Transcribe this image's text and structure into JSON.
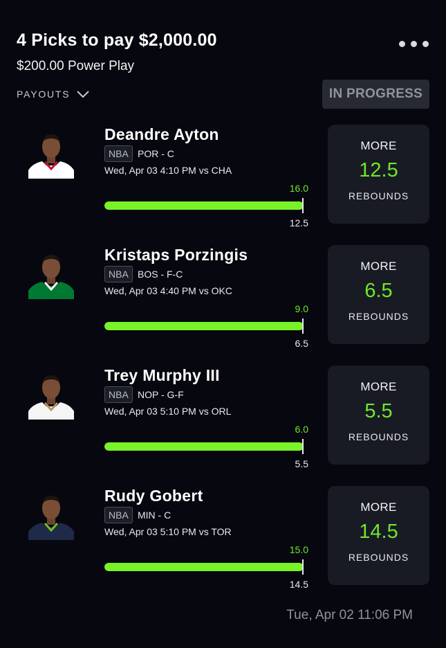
{
  "header": {
    "title": "4 Picks to pay $2,000.00",
    "subtitle": "$200.00 Power Play",
    "more_icon": "more-horizontal-icon",
    "payouts_label": "PAYOUTS",
    "payouts_icon": "chevron-down-icon",
    "status": "IN PROGRESS"
  },
  "colors": {
    "background": "#07080f",
    "accent_green": "#79f227",
    "card": "#181b24",
    "status_badge": "#272a33"
  },
  "picks": [
    {
      "name": "Deandre Ayton",
      "league": "NBA",
      "team_pos": "POR - C",
      "game": "Wed, Apr 03 4:10 PM  vs CHA",
      "actual": "16.0",
      "line": "12.5",
      "progress": 1.0,
      "direction": "MORE",
      "projection": "12.5",
      "stat": "REBOUNDS",
      "jersey_color": "#ffffff",
      "trim_color": "#c8102e"
    },
    {
      "name": "Kristaps Porzingis",
      "league": "NBA",
      "team_pos": "BOS - F-C",
      "game": "Wed, Apr 03 4:40 PM  vs OKC",
      "actual": "9.0",
      "line": "6.5",
      "progress": 1.0,
      "direction": "MORE",
      "projection": "6.5",
      "stat": "REBOUNDS",
      "jersey_color": "#007a33",
      "trim_color": "#ffffff"
    },
    {
      "name": "Trey Murphy III",
      "league": "NBA",
      "team_pos": "NOP - G-F",
      "game": "Wed, Apr 03 5:10 PM  vs ORL",
      "actual": "6.0",
      "line": "5.5",
      "progress": 1.0,
      "direction": "MORE",
      "projection": "5.5",
      "stat": "REBOUNDS",
      "jersey_color": "#f5f5f5",
      "trim_color": "#b4975a"
    },
    {
      "name": "Rudy Gobert",
      "league": "NBA",
      "team_pos": "MIN - C",
      "game": "Wed, Apr 03 5:10 PM  vs TOR",
      "actual": "15.0",
      "line": "14.5",
      "progress": 1.0,
      "direction": "MORE",
      "projection": "14.5",
      "stat": "REBOUNDS",
      "jersey_color": "#1f2a48",
      "trim_color": "#78be20"
    }
  ],
  "footer": {
    "timestamp": "Tue, Apr 02 11:06 PM"
  }
}
